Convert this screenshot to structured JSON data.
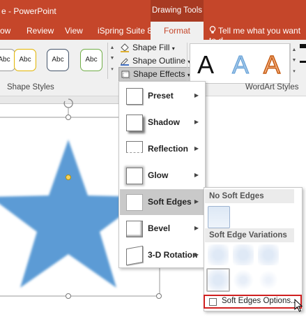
{
  "titlebar": {
    "left_text": "e  -  PowerPoint",
    "contextual": "Drawing Tools"
  },
  "tabs": [
    "ow",
    "Review",
    "View",
    "iSpring Suite 8",
    "Format"
  ],
  "tell_me": "Tell me what you want to d",
  "ribbon": {
    "style_previews": [
      "Abc",
      "Abc",
      "Abc",
      "Abc"
    ],
    "shape_fill": "Shape Fill",
    "shape_outline": "Shape Outline",
    "shape_effects": "Shape Effects",
    "wordart_letters": [
      "A",
      "A",
      "A"
    ],
    "group_shape_styles": "Shape Styles",
    "group_wordart_styles": "WordArt Styles"
  },
  "menu": {
    "items": [
      "Preset",
      "Shadow",
      "Reflection",
      "Glow",
      "Soft Edges",
      "Bevel",
      "3-D Rotation"
    ],
    "selected": "Soft Edges"
  },
  "submenu": {
    "no_soft_edges": "No Soft Edges",
    "variations_header": "Soft Edge Variations",
    "options_label": "Soft Edges Options..."
  },
  "colors": {
    "accent": "#c5462a",
    "star_fill": "#5b9bd5",
    "highlight_border": "#d02020"
  }
}
